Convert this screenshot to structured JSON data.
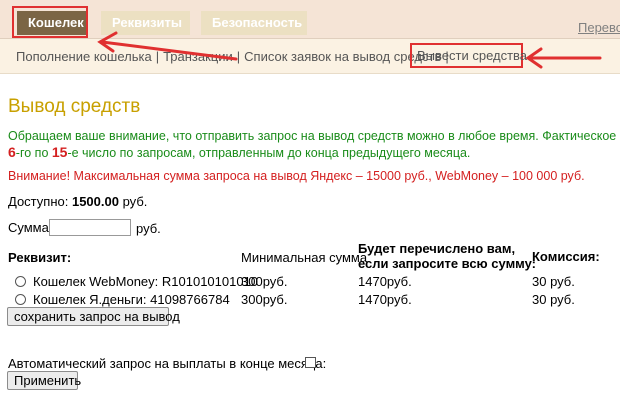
{
  "tabs": [
    {
      "label": "Кошелек",
      "active": true
    },
    {
      "label": "Реквизиты",
      "active": false
    },
    {
      "label": "Безопасность",
      "active": false
    }
  ],
  "header": {
    "right_link": "Перевод"
  },
  "subnav": {
    "items": [
      "Пополнение кошелька",
      "Транзакции",
      "Список заявок на вывод средств"
    ],
    "active_item": "Вывести средства"
  },
  "page": {
    "title": "Вывод средств",
    "notice_green_1": "Обращаем ваше внимание, что отправить запрос на вывод средств можно в любое время. Фактическое перечисление",
    "notice_green_2_num1": "6",
    "notice_green_2_mid": "-го по ",
    "notice_green_2_num2": "15",
    "notice_green_2_end": "-е число по запросам, отправленным до конца предыдущего месяца.",
    "notice_red": "Внимание! Максимальная сумма запроса на вывод Яндекс – 15000 руб., WebMoney – 100 000 руб.",
    "available_label": "Доступно:",
    "available_value": "1500.00",
    "available_unit": "руб.",
    "sum_label": "Сумма:",
    "sum_unit": "руб."
  },
  "table": {
    "headers": {
      "rekv": "Реквизит:",
      "min": "Минимальная сумма",
      "budet_1": "Будет перечислено вам,",
      "budet_2": "если запросите всю сумму:",
      "kom": "Комиссия:"
    },
    "rows": [
      {
        "name": "Кошелек WebMoney: R101010101010",
        "min": "300руб.",
        "budet": "1470руб.",
        "kom": "30 руб."
      },
      {
        "name": "Кошелек Я.деньги: 41098766784",
        "min": "300руб.",
        "budet": "1470руб.",
        "kom": "30 руб."
      }
    ]
  },
  "buttons": {
    "save": "сохранить запрос на вывод",
    "apply": "Применить"
  },
  "auto_request_label": "Автоматический запрос на выплаты в конце месяца:",
  "colors": {
    "tab_active": "#7b6545",
    "tab_inactive": "#ece0c2",
    "highlight": "#e03030",
    "title": "#c8a000",
    "notice_green": "#1a8c1a",
    "notice_red": "#d42020"
  }
}
